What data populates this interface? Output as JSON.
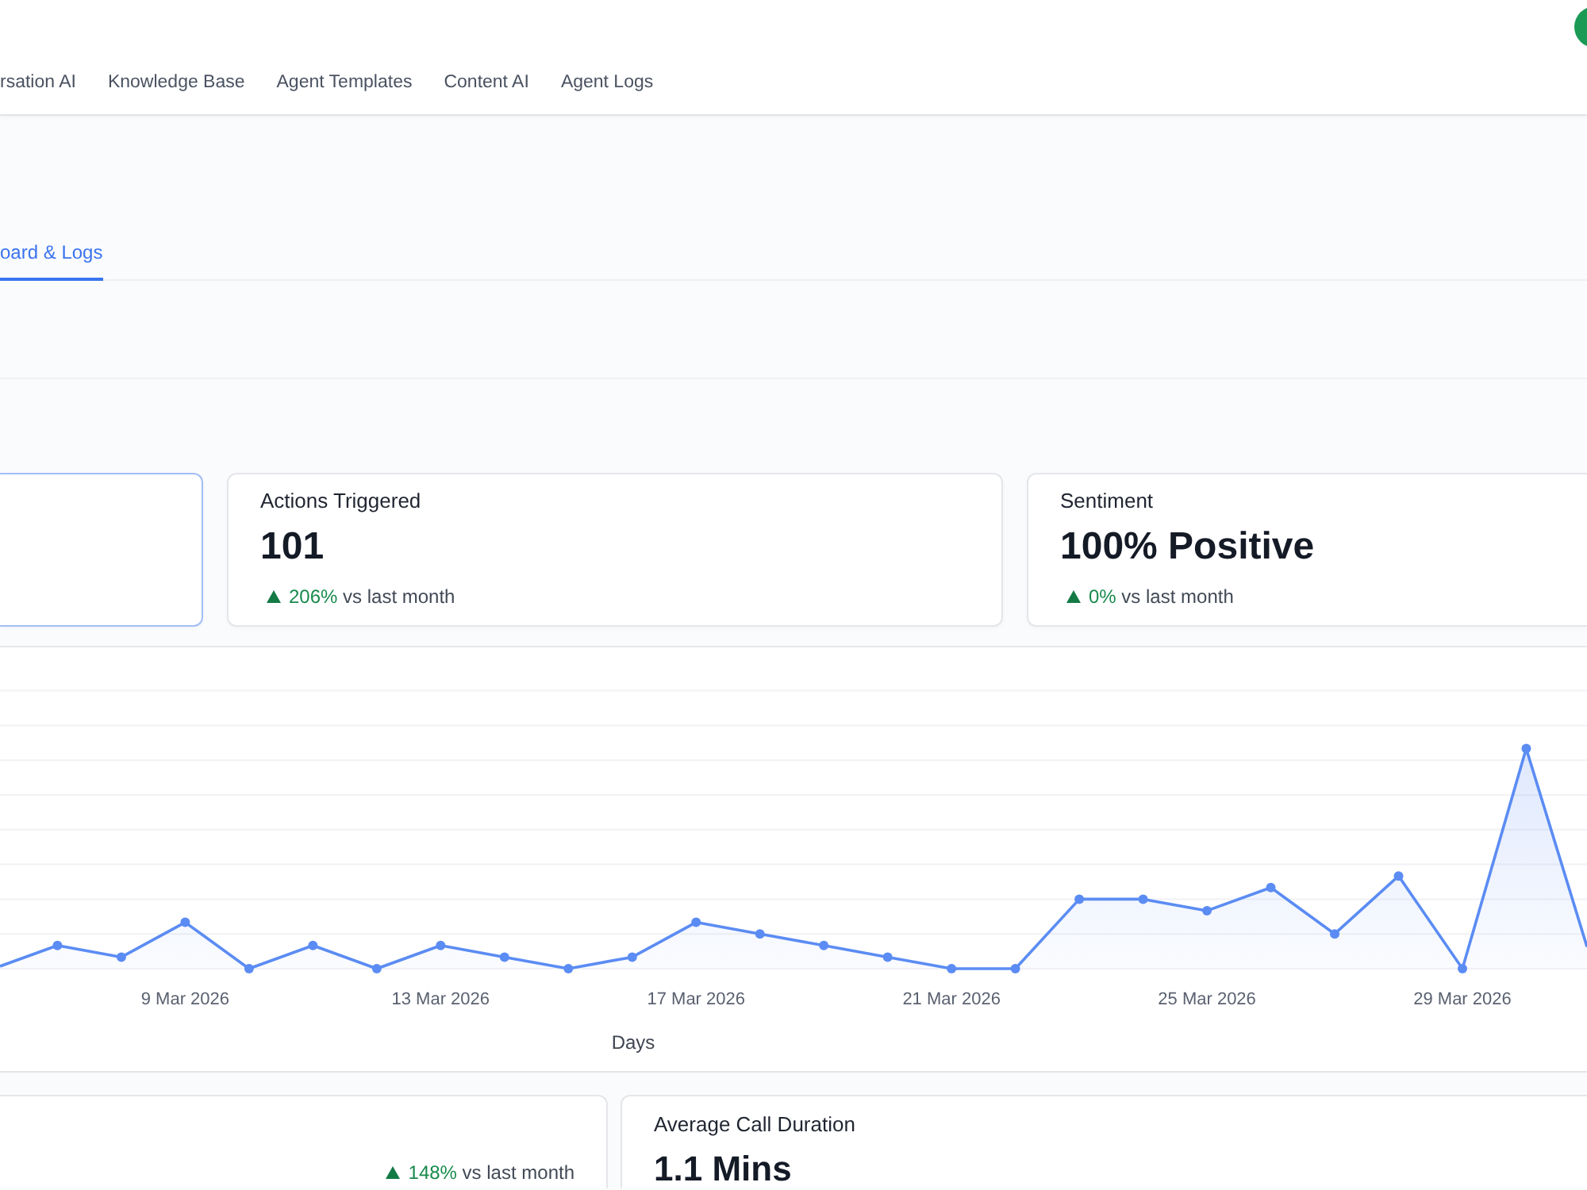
{
  "header": {
    "nav_items": [
      {
        "label": "rsation AI",
        "selected": false
      },
      {
        "label": "Knowledge Base",
        "selected": false
      },
      {
        "label": "Agent Templates",
        "selected": false
      },
      {
        "label": "Content AI",
        "selected": false
      },
      {
        "label": "Agent Logs",
        "selected": false
      }
    ]
  },
  "tabs": [
    {
      "label": "oard & Logs",
      "selected": true
    }
  ],
  "metric_cards": [
    {
      "selected": true
    },
    {
      "title": "Actions Triggered",
      "value": "101",
      "change": "206%",
      "change_note": "vs last month",
      "trend_up": true,
      "selected": false
    },
    {
      "title": "Sentiment",
      "value": "100% Positive",
      "change": "0%",
      "change_note": "vs last month",
      "trend_up": true,
      "selected": false
    }
  ],
  "chart": {
    "x_labels": [
      "9 Mar 2026",
      "13 Mar 2026",
      "17 Mar 2026",
      "21 Mar 2026",
      "25 Mar 2026",
      "29 Mar 2026"
    ],
    "x_axis_title": "Days"
  },
  "bottom_cards": [
    {
      "change": "148%",
      "change_note": "vs last month",
      "trend_up": true
    },
    {
      "title": "Average Call Duration",
      "value": "1.1 Mins"
    }
  ]
}
